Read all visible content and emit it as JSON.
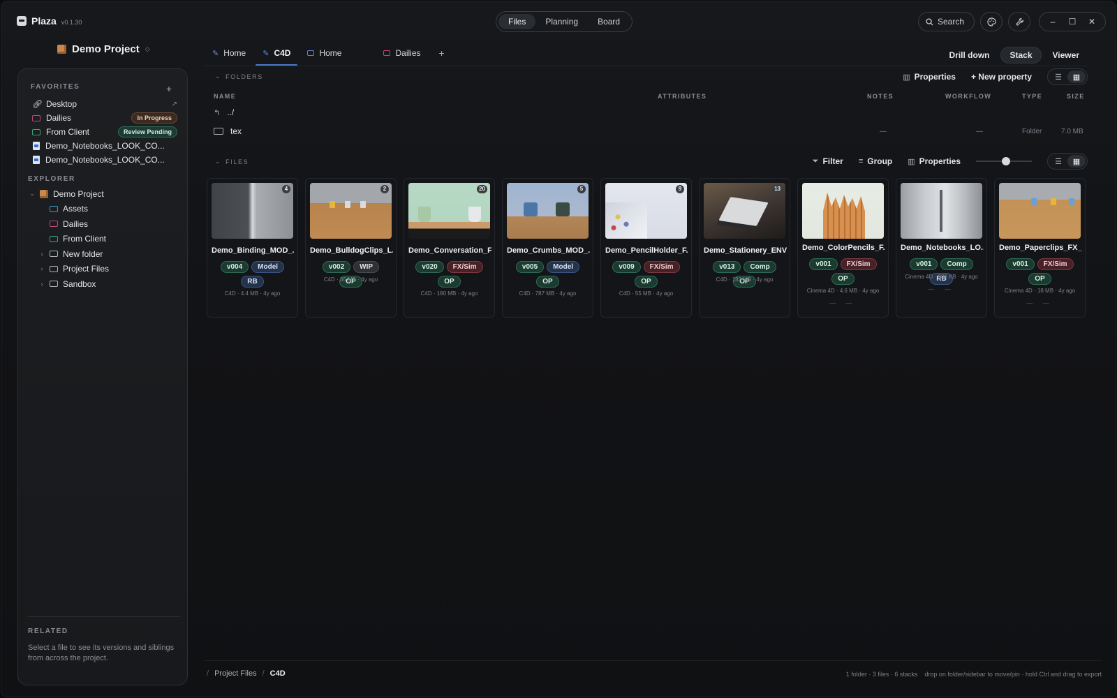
{
  "app": {
    "name": "Plaza",
    "version": "v0.1.30"
  },
  "modes": [
    "Files",
    "Planning",
    "Board"
  ],
  "toolbar_right": {
    "search_label": "Search"
  },
  "project": {
    "title": "Demo Project"
  },
  "favorites": {
    "label": "FAVORITES",
    "items": [
      {
        "label": "Desktop",
        "icon": "link-icon"
      },
      {
        "label": "Dailies",
        "badge": "In Progress",
        "color": "#c2477a"
      },
      {
        "label": "From Client",
        "badge": "Review Pending",
        "color": "#3aa57c"
      },
      {
        "label": "Demo_Notebooks_LOOK_CO..."
      },
      {
        "label": "Demo_Notebooks_LOOK_CO..."
      }
    ]
  },
  "explorer": {
    "label": "EXPLORER",
    "root": "Demo Project",
    "items": [
      {
        "label": "Assets",
        "color": "#3a9bc2"
      },
      {
        "label": "Dailies",
        "color": "#c2477a"
      },
      {
        "label": "From Client",
        "color": "#3aa57c"
      },
      {
        "label": "New folder",
        "color": "#aeb1b6"
      },
      {
        "label": "Project Files",
        "color": "#aeb1b6"
      },
      {
        "label": "Sandbox",
        "color": "#aeb1b6"
      }
    ]
  },
  "related": {
    "label": "RELATED",
    "text": "Select a file to see its versions and siblings from across the project."
  },
  "tabs": [
    {
      "label": "Home",
      "color": "#7a8be0"
    },
    {
      "label": "C4D",
      "color": "#5a8ee0"
    },
    {
      "label": "Home",
      "color": "#6a7ad8"
    },
    {
      "label": "Dailies",
      "color": "#c2477a"
    }
  ],
  "views": [
    "Drill down",
    "Stack",
    "Viewer"
  ],
  "folders_section": {
    "label": "FOLDERS",
    "properties": "Properties",
    "new_property": "+ New property",
    "columns": {
      "name": "NAME",
      "attributes": "ATTRIBUTES",
      "notes": "NOTES",
      "workflow": "WORKFLOW",
      "type": "TYPE",
      "size": "SIZE"
    },
    "up": "../",
    "rows": [
      {
        "name": "tex",
        "notes": "—",
        "workflow": "—",
        "type": "Folder",
        "size": "7.0 MB"
      }
    ]
  },
  "files_section": {
    "label": "FILES",
    "filter": "Filter",
    "group": "Group",
    "properties": "Properties",
    "thumb_size": 0.55
  },
  "cards": [
    {
      "name": "Demo_Binding_MOD_...",
      "count": "4",
      "chips": [
        "v004",
        "Model",
        "RB"
      ],
      "meta": "C4D · 4.4 MB · 4y ago"
    },
    {
      "name": "Demo_BulldogClips_L...",
      "count": "2",
      "chips": [
        "v002",
        "WIP",
        "OP"
      ],
      "meta": "C4D · 36 MB · 4y ago"
    },
    {
      "name": "Demo_Conversation_F...",
      "count": "20",
      "chips": [
        "v020",
        "FX/Sim",
        "OP"
      ],
      "meta": "C4D · 180 MB · 4y ago"
    },
    {
      "name": "Demo_Crumbs_MOD_...",
      "count": "5",
      "chips": [
        "v005",
        "Model",
        "OP"
      ],
      "meta": "C4D · 787 MB · 4y ago"
    },
    {
      "name": "Demo_PencilHolder_F...",
      "count": "9",
      "chips": [
        "v009",
        "FX/Sim",
        "OP"
      ],
      "meta": "C4D · 55 MB · 4y ago"
    },
    {
      "name": "Demo_Stationery_ENV...",
      "count": "13",
      "chips": [
        "v013",
        "Comp",
        "OP"
      ],
      "meta": "C4D · 183 MB · 4y ago"
    },
    {
      "name": "Demo_ColorPencils_F...",
      "chips": [
        "v001",
        "FX/Sim",
        "OP"
      ],
      "meta": "Cinema 4D · 4.6 MB · 4y ago",
      "dashes": "— —"
    },
    {
      "name": "Demo_Notebooks_LO...",
      "chips": [
        "v001",
        "Comp",
        "RB"
      ],
      "meta": "Cinema 4D · 888 KB · 4y ago",
      "dashes": "— —"
    },
    {
      "name": "Demo_Paperclips_FX_...",
      "chips": [
        "v001",
        "FX/Sim",
        "OP"
      ],
      "meta": "Cinema 4D · 18 MB · 4y ago",
      "dashes": "— —"
    }
  ],
  "breadcrumb": [
    "Project Files",
    "C4D"
  ],
  "status": {
    "counts": "1 folder · 3 files · 6 stacks",
    "hint": "drop on folder/sidebar to move/pin · hold Ctrl and drag to export"
  }
}
